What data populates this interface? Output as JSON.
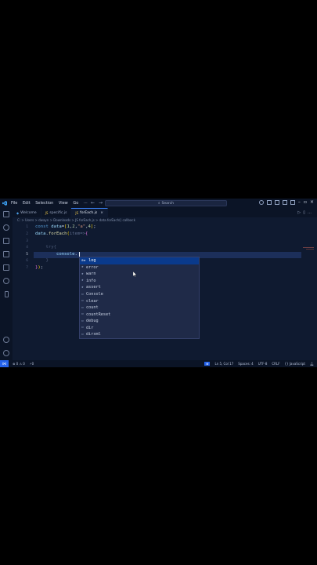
{
  "menu": {
    "items": [
      "File",
      "Edit",
      "Selection",
      "View",
      "Go",
      "···"
    ]
  },
  "titlebar": {
    "search_label": "Search",
    "nav_back": "←",
    "nav_forward": "→"
  },
  "tabs": [
    {
      "label": "Welcome",
      "icon": "vscode-icon"
    },
    {
      "label": "specific.js",
      "icon": "js-file-icon"
    },
    {
      "label": "forEach.js",
      "icon": "js-file-icon",
      "active": true
    }
  ],
  "breadcrumb": "C: > Users > dwayn > Downloads > JS forEach.js > data.forEach() callback",
  "editor": {
    "line_numbers": [
      "1",
      "2",
      "3",
      "4",
      "5",
      "6",
      "7"
    ],
    "current_line": "5"
  },
  "suggestions": [
    {
      "label": "log",
      "icon": "star-method-icon",
      "selected": true
    },
    {
      "label": "error",
      "icon": "star-method-icon"
    },
    {
      "label": "warn",
      "icon": "star-method-icon"
    },
    {
      "label": "info",
      "icon": "star-method-icon"
    },
    {
      "label": "assert",
      "icon": "star-method-icon"
    },
    {
      "label": "Console",
      "icon": "class-icon"
    },
    {
      "label": "clear",
      "icon": "method-icon"
    },
    {
      "label": "count",
      "icon": "method-icon"
    },
    {
      "label": "countReset",
      "icon": "method-icon"
    },
    {
      "label": "debug",
      "icon": "method-icon"
    },
    {
      "label": "dir",
      "icon": "method-icon"
    },
    {
      "label": "dirxml",
      "icon": "method-icon"
    }
  ],
  "status": {
    "problems": "⊗ 0 ⚠ 0",
    "ports": "⚡0",
    "position": "Ln 5, Col 17",
    "spaces": "Spaces: 4",
    "encoding": "UTF-8",
    "eol": "CRLF",
    "language": "{} JavaScript"
  },
  "colors": {
    "accent": "#2563eb",
    "editor_bg": "#0f1a30",
    "selection": "#0a3a8c"
  }
}
